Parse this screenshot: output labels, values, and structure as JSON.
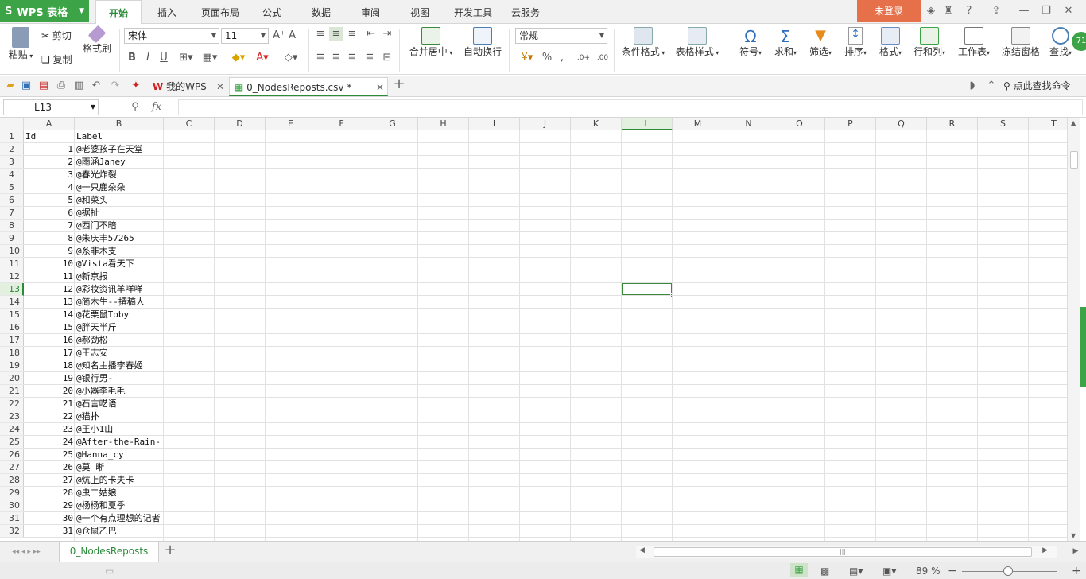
{
  "app": {
    "name": "WPS 表格",
    "login_label": "未登录"
  },
  "ribbon_tabs": [
    "开始",
    "插入",
    "页面布局",
    "公式",
    "数据",
    "审阅",
    "视图",
    "开发工具",
    "云服务"
  ],
  "toolbar": {
    "paste": "粘贴",
    "cut": "剪切",
    "copy": "复制",
    "format_painter": "格式刷",
    "font_name": "宋体",
    "font_size": "11",
    "merge_center": "合并居中",
    "wrap_text": "自动换行",
    "number_format": "常规",
    "conditional_format": "条件格式",
    "table_style": "表格样式",
    "symbol": "符号",
    "sum": "求和",
    "filter": "筛选",
    "sort": "排序",
    "format": "格式",
    "row_col": "行和列",
    "worksheet": "工作表",
    "freeze": "冻结窗格",
    "find": "查找",
    "badge": "71"
  },
  "doc_tabs": [
    {
      "label": "我的WPS",
      "active": false
    },
    {
      "label": "0_NodesReposts.csv *",
      "active": true
    }
  ],
  "search_cmd": "点此查找命令",
  "formula_bar": {
    "cell_ref": "L13",
    "fx": "fx",
    "value": ""
  },
  "sheet": {
    "columns": [
      "A",
      "B",
      "C",
      "D",
      "E",
      "F",
      "G",
      "H",
      "I",
      "J",
      "K",
      "L",
      "M",
      "N",
      "O",
      "P",
      "Q",
      "R",
      "S",
      "T"
    ],
    "selected_col": "L",
    "selected_row": 13,
    "header": [
      "Id",
      "Label"
    ],
    "rows": [
      [
        1,
        "@老婆孩子在天堂"
      ],
      [
        2,
        "@雨涵Janey"
      ],
      [
        3,
        "@春光炸裂"
      ],
      [
        4,
        "@一只鹿朵朵"
      ],
      [
        5,
        "@和菜头"
      ],
      [
        6,
        "@据扯"
      ],
      [
        7,
        "@西门不暗"
      ],
      [
        8,
        "@朱庆丰57265"
      ],
      [
        9,
        "@糸非木支"
      ],
      [
        10,
        "@Vista看天下"
      ],
      [
        11,
        "@新京报"
      ],
      [
        12,
        "@彩妆资讯羊咩咩"
      ],
      [
        13,
        "@简木生--撰稿人"
      ],
      [
        14,
        "@花栗鼠Toby"
      ],
      [
        15,
        "@胖天半斤"
      ],
      [
        16,
        "@郝劲松"
      ],
      [
        17,
        "@王志安"
      ],
      [
        18,
        "@知名主播李春姬"
      ],
      [
        19,
        "@银行男-"
      ],
      [
        20,
        "@小器李毛毛"
      ],
      [
        21,
        "@石言呓语"
      ],
      [
        22,
        "@猫扑"
      ],
      [
        23,
        "@王小1山"
      ],
      [
        24,
        "@After-the-Rain-"
      ],
      [
        25,
        "@Hanna_cy"
      ],
      [
        26,
        "@莫_晰"
      ],
      [
        27,
        "@炕上的卡夫卡"
      ],
      [
        28,
        "@虫二姑娘"
      ],
      [
        29,
        "@杨杨和夏季"
      ],
      [
        30,
        "@一个有点理想的记者"
      ],
      [
        31,
        "@仓鼠乙巴"
      ]
    ],
    "row_numbers": [
      1,
      2,
      3,
      4,
      5,
      6,
      7,
      8,
      9,
      10,
      11,
      12,
      13,
      14,
      15,
      16,
      17,
      18,
      19,
      20,
      21,
      22,
      23,
      24,
      25,
      26,
      27,
      28,
      29,
      30,
      31,
      32
    ]
  },
  "sheet_tab": "0_NodesReposts",
  "status": {
    "zoom": "89 %"
  },
  "colors": {
    "accent": "#3ca447",
    "login": "#e6704a",
    "selection": "#3b8a3b"
  }
}
